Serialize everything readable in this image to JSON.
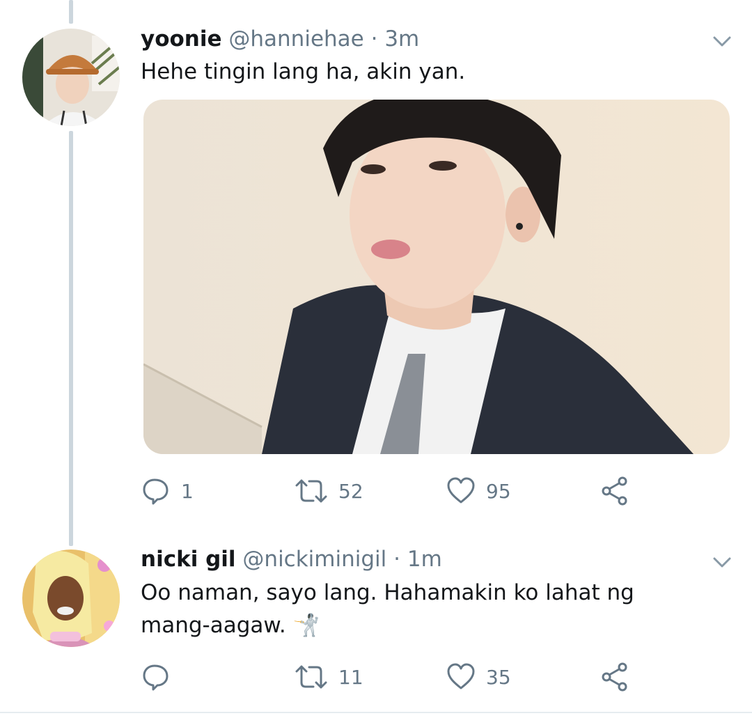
{
  "tweets": [
    {
      "name": "yoonie",
      "handle": "@hanniehae",
      "dot": "·",
      "time": "3m",
      "text": "Hehe tingin lang ha, akin yan.",
      "replies": "1",
      "retweets": "52",
      "likes": "95",
      "avatar_icon": "avatar-photo",
      "has_media": true
    },
    {
      "name": "nicki gil",
      "handle": "@nickiminigil",
      "dot": "·",
      "time": "1m",
      "text_line1": "Oo naman, sayo lang. Hahamakin ko lahat ng",
      "text_line2": "mang-aagaw.",
      "emoji": "🤺",
      "replies": "",
      "retweets": "11",
      "likes": "35",
      "avatar_icon": "avatar-photo",
      "has_media": false
    }
  ],
  "icons": {
    "reply": "reply-icon",
    "retweet": "retweet-icon",
    "like": "heart-icon",
    "share": "share-icon",
    "caret": "chevron-down-icon"
  },
  "colors": {
    "icon_gray": "#657786",
    "thread_line": "#ccd6dd"
  }
}
